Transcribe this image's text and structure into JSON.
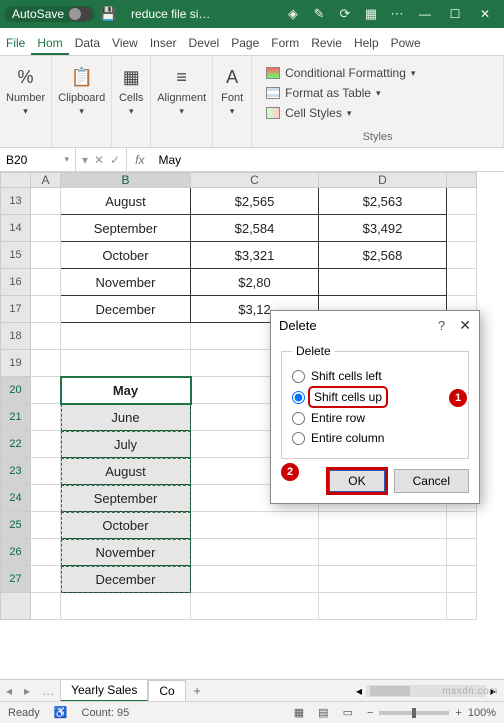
{
  "titlebar": {
    "autosave": "AutoSave",
    "filename": "reduce file si…"
  },
  "tabs": {
    "file": "File",
    "home": "Hom",
    "data": "Data",
    "view": "View",
    "insert": "Inser",
    "devel": "Devel",
    "page": "Page",
    "form": "Form",
    "revie": "Revie",
    "help": "Help",
    "powe": "Powe"
  },
  "ribbon": {
    "number": "Number",
    "clipboard": "Clipboard",
    "cells": "Cells",
    "alignment": "Alignment",
    "font": "Font",
    "cond": "Conditional Formatting",
    "table": "Format as Table",
    "styles": "Cell Styles",
    "styles_lbl": "Styles"
  },
  "namebox": {
    "ref": "B20",
    "fx": "fx",
    "val": "May"
  },
  "cols": {
    "A": "A",
    "B": "B",
    "C": "C",
    "D": "D"
  },
  "rows": {
    "top": [
      {
        "n": "13",
        "b": "August",
        "c": "$2,565",
        "d": "$2,563"
      },
      {
        "n": "14",
        "b": "September",
        "c": "$2,584",
        "d": "$3,492"
      },
      {
        "n": "15",
        "b": "October",
        "c": "$3,321",
        "d": "$2,568"
      },
      {
        "n": "16",
        "b": "November",
        "c": "$2,80",
        "d": ""
      },
      {
        "n": "17",
        "b": "December",
        "c": "$3,12",
        "d": ""
      }
    ],
    "gap": "18",
    "r19": "19",
    "months": [
      {
        "n": "20",
        "b": "May"
      },
      {
        "n": "21",
        "b": "June"
      },
      {
        "n": "22",
        "b": "July"
      },
      {
        "n": "23",
        "b": "August"
      },
      {
        "n": "24",
        "b": "September"
      },
      {
        "n": "25",
        "b": "October"
      },
      {
        "n": "26",
        "b": "November"
      },
      {
        "n": "27",
        "b": "December"
      }
    ]
  },
  "dialog": {
    "title": "Delete",
    "legend": "Delete",
    "opt1": "Shift cells left",
    "opt2": "Shift cells up",
    "opt3": "Entire row",
    "opt4": "Entire column",
    "ok": "OK",
    "cancel": "Cancel"
  },
  "sheettabs": {
    "t1": "Yearly Sales",
    "t2": "Co",
    "plus": "+"
  },
  "status": {
    "ready": "Ready",
    "count": "Count: 95",
    "zoom": "100%"
  },
  "callouts": {
    "c1": "1",
    "c2": "2"
  },
  "watermark": "msxdn.com"
}
